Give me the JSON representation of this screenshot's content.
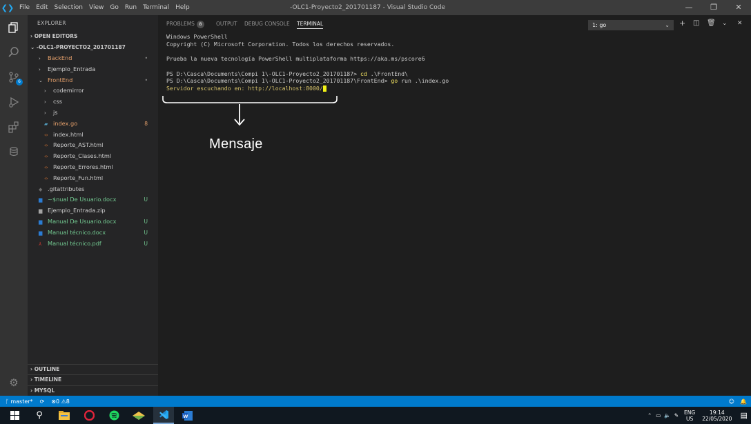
{
  "titlebar": {
    "menu": [
      "File",
      "Edit",
      "Selection",
      "View",
      "Go",
      "Run",
      "Terminal",
      "Help"
    ],
    "window_title": "-OLC1-Proyecto2_201701187 - Visual Studio Code"
  },
  "activity_bar": {
    "scm_badge": "6"
  },
  "explorer": {
    "title": "EXPLORER",
    "open_editors": "OPEN EDITORS",
    "root": "-OLC1-PROYECTO2_201701187",
    "tree": [
      {
        "label": "BackEnd",
        "indent": 1,
        "type": "folder-closed",
        "color": "#e5a06b",
        "mark": "•",
        "mark_color": "#888888"
      },
      {
        "label": "Ejemplo_Entrada",
        "indent": 1,
        "type": "folder-closed",
        "color": "#cccccc",
        "mark": "",
        "mark_color": ""
      },
      {
        "label": "FrontEnd",
        "indent": 1,
        "type": "folder-open",
        "color": "#e5a06b",
        "mark": "•",
        "mark_color": "#888888"
      },
      {
        "label": "codemirror",
        "indent": 2,
        "type": "folder-closed",
        "color": "#cccccc",
        "mark": "",
        "mark_color": ""
      },
      {
        "label": "css",
        "indent": 2,
        "type": "folder-closed",
        "color": "#cccccc",
        "mark": "",
        "mark_color": ""
      },
      {
        "label": "js",
        "indent": 2,
        "type": "folder-closed",
        "color": "#cccccc",
        "mark": "",
        "mark_color": ""
      },
      {
        "label": "index.go",
        "indent": 2,
        "type": "go",
        "color": "#e5a06b",
        "mark": "8",
        "mark_color": "#e5a06b"
      },
      {
        "label": "index.html",
        "indent": 2,
        "type": "html",
        "color": "#cccccc",
        "mark": "",
        "mark_color": ""
      },
      {
        "label": "Reporte_AST.html",
        "indent": 2,
        "type": "html",
        "color": "#cccccc",
        "mark": "",
        "mark_color": ""
      },
      {
        "label": "Reporte_Clases.html",
        "indent": 2,
        "type": "html",
        "color": "#cccccc",
        "mark": "",
        "mark_color": ""
      },
      {
        "label": "Reporte_Errores.html",
        "indent": 2,
        "type": "html",
        "color": "#cccccc",
        "mark": "",
        "mark_color": ""
      },
      {
        "label": "Reporte_Fun.html",
        "indent": 2,
        "type": "html",
        "color": "#cccccc",
        "mark": "",
        "mark_color": ""
      },
      {
        "label": ".gitattributes",
        "indent": 1,
        "type": "git",
        "color": "#cccccc",
        "mark": "",
        "mark_color": ""
      },
      {
        "label": "~$nual De Usuario.docx",
        "indent": 1,
        "type": "word",
        "color": "#73c991",
        "mark": "U",
        "mark_color": "#73c991"
      },
      {
        "label": "Ejemplo_Entrada.zip",
        "indent": 1,
        "type": "zip",
        "color": "#cccccc",
        "mark": "",
        "mark_color": ""
      },
      {
        "label": "Manual De Usuario.docx",
        "indent": 1,
        "type": "word",
        "color": "#73c991",
        "mark": "U",
        "mark_color": "#73c991"
      },
      {
        "label": "Manual técnico.docx",
        "indent": 1,
        "type": "word",
        "color": "#73c991",
        "mark": "U",
        "mark_color": "#73c991"
      },
      {
        "label": "Manual técnico.pdf",
        "indent": 1,
        "type": "pdf",
        "color": "#73c991",
        "mark": "U",
        "mark_color": "#73c991"
      }
    ],
    "bottom_sections": [
      "OUTLINE",
      "TIMELINE",
      "MYSQL"
    ]
  },
  "panel": {
    "tabs": [
      "PROBLEMS",
      "OUTPUT",
      "DEBUG CONSOLE",
      "TERMINAL"
    ],
    "problems_badge": "8",
    "terminal_select": "1: go",
    "terminal_lines": {
      "l1": "Windows PowerShell",
      "l2": "Copyright (C) Microsoft Corporation. Todos los derechos reservados.",
      "l3": "Prueba la nueva tecnología PowerShell multiplataforma https://aka.ms/pscore6",
      "l4_prompt": "PS D:\\Casca\\Documents\\Compi 1\\-OLC1-Proyecto2_201701187> ",
      "l4_cmd": "cd",
      "l4_rest": " .\\FrontEnd\\",
      "l5_prompt": "PS D:\\Casca\\Documents\\Compi 1\\-OLC1-Proyecto2_201701187\\FrontEnd> ",
      "l5_cmd": "go",
      "l5_rest": " run .\\index.go",
      "l6": "Servidor escuchando en: http://localhost:8000/"
    }
  },
  "annotation": {
    "label": "Mensaje"
  },
  "statusbar": {
    "branch": "master*",
    "errors": "0",
    "warnings": "8"
  },
  "tray": {
    "lang": "ENG",
    "region": "US",
    "time": "19:14",
    "date": "22/05/2020"
  }
}
